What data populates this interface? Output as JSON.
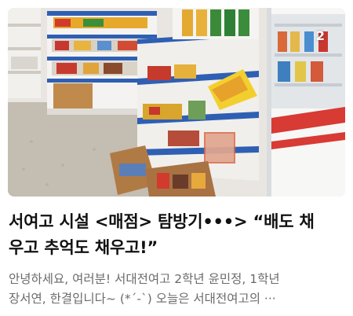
{
  "card": {
    "image_count_badge": "2",
    "title_lines": [
      "서여고 시설 <매점> 탐방기•••> “배도 채",
      "우고 추억도 채우고!”"
    ],
    "excerpt_lines": [
      "안녕하세요, 여러분! 서대전여고 2학년 윤민정, 1학년",
      "장서연, 한결입니다~ (*´-`) 오늘은 서대전여고의 ···"
    ]
  },
  "colors": {
    "title_text": "#111111",
    "excerpt_text": "#6a6a6a",
    "shelf_blue": "#2f5fb3",
    "cooler_red": "#d83a34"
  }
}
